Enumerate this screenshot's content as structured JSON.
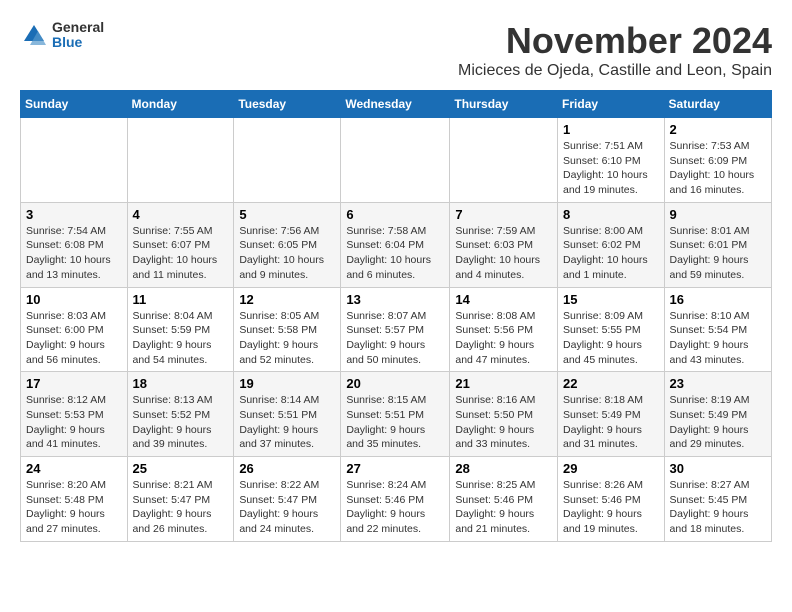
{
  "logo": {
    "general": "General",
    "blue": "Blue"
  },
  "title": "November 2024",
  "location": "Micieces de Ojeda, Castille and Leon, Spain",
  "weekdays": [
    "Sunday",
    "Monday",
    "Tuesday",
    "Wednesday",
    "Thursday",
    "Friday",
    "Saturday"
  ],
  "weeks": [
    [
      {
        "day": "",
        "info": ""
      },
      {
        "day": "",
        "info": ""
      },
      {
        "day": "",
        "info": ""
      },
      {
        "day": "",
        "info": ""
      },
      {
        "day": "",
        "info": ""
      },
      {
        "day": "1",
        "info": "Sunrise: 7:51 AM\nSunset: 6:10 PM\nDaylight: 10 hours and 19 minutes."
      },
      {
        "day": "2",
        "info": "Sunrise: 7:53 AM\nSunset: 6:09 PM\nDaylight: 10 hours and 16 minutes."
      }
    ],
    [
      {
        "day": "3",
        "info": "Sunrise: 7:54 AM\nSunset: 6:08 PM\nDaylight: 10 hours and 13 minutes."
      },
      {
        "day": "4",
        "info": "Sunrise: 7:55 AM\nSunset: 6:07 PM\nDaylight: 10 hours and 11 minutes."
      },
      {
        "day": "5",
        "info": "Sunrise: 7:56 AM\nSunset: 6:05 PM\nDaylight: 10 hours and 9 minutes."
      },
      {
        "day": "6",
        "info": "Sunrise: 7:58 AM\nSunset: 6:04 PM\nDaylight: 10 hours and 6 minutes."
      },
      {
        "day": "7",
        "info": "Sunrise: 7:59 AM\nSunset: 6:03 PM\nDaylight: 10 hours and 4 minutes."
      },
      {
        "day": "8",
        "info": "Sunrise: 8:00 AM\nSunset: 6:02 PM\nDaylight: 10 hours and 1 minute."
      },
      {
        "day": "9",
        "info": "Sunrise: 8:01 AM\nSunset: 6:01 PM\nDaylight: 9 hours and 59 minutes."
      }
    ],
    [
      {
        "day": "10",
        "info": "Sunrise: 8:03 AM\nSunset: 6:00 PM\nDaylight: 9 hours and 56 minutes."
      },
      {
        "day": "11",
        "info": "Sunrise: 8:04 AM\nSunset: 5:59 PM\nDaylight: 9 hours and 54 minutes."
      },
      {
        "day": "12",
        "info": "Sunrise: 8:05 AM\nSunset: 5:58 PM\nDaylight: 9 hours and 52 minutes."
      },
      {
        "day": "13",
        "info": "Sunrise: 8:07 AM\nSunset: 5:57 PM\nDaylight: 9 hours and 50 minutes."
      },
      {
        "day": "14",
        "info": "Sunrise: 8:08 AM\nSunset: 5:56 PM\nDaylight: 9 hours and 47 minutes."
      },
      {
        "day": "15",
        "info": "Sunrise: 8:09 AM\nSunset: 5:55 PM\nDaylight: 9 hours and 45 minutes."
      },
      {
        "day": "16",
        "info": "Sunrise: 8:10 AM\nSunset: 5:54 PM\nDaylight: 9 hours and 43 minutes."
      }
    ],
    [
      {
        "day": "17",
        "info": "Sunrise: 8:12 AM\nSunset: 5:53 PM\nDaylight: 9 hours and 41 minutes."
      },
      {
        "day": "18",
        "info": "Sunrise: 8:13 AM\nSunset: 5:52 PM\nDaylight: 9 hours and 39 minutes."
      },
      {
        "day": "19",
        "info": "Sunrise: 8:14 AM\nSunset: 5:51 PM\nDaylight: 9 hours and 37 minutes."
      },
      {
        "day": "20",
        "info": "Sunrise: 8:15 AM\nSunset: 5:51 PM\nDaylight: 9 hours and 35 minutes."
      },
      {
        "day": "21",
        "info": "Sunrise: 8:16 AM\nSunset: 5:50 PM\nDaylight: 9 hours and 33 minutes."
      },
      {
        "day": "22",
        "info": "Sunrise: 8:18 AM\nSunset: 5:49 PM\nDaylight: 9 hours and 31 minutes."
      },
      {
        "day": "23",
        "info": "Sunrise: 8:19 AM\nSunset: 5:49 PM\nDaylight: 9 hours and 29 minutes."
      }
    ],
    [
      {
        "day": "24",
        "info": "Sunrise: 8:20 AM\nSunset: 5:48 PM\nDaylight: 9 hours and 27 minutes."
      },
      {
        "day": "25",
        "info": "Sunrise: 8:21 AM\nSunset: 5:47 PM\nDaylight: 9 hours and 26 minutes."
      },
      {
        "day": "26",
        "info": "Sunrise: 8:22 AM\nSunset: 5:47 PM\nDaylight: 9 hours and 24 minutes."
      },
      {
        "day": "27",
        "info": "Sunrise: 8:24 AM\nSunset: 5:46 PM\nDaylight: 9 hours and 22 minutes."
      },
      {
        "day": "28",
        "info": "Sunrise: 8:25 AM\nSunset: 5:46 PM\nDaylight: 9 hours and 21 minutes."
      },
      {
        "day": "29",
        "info": "Sunrise: 8:26 AM\nSunset: 5:46 PM\nDaylight: 9 hours and 19 minutes."
      },
      {
        "day": "30",
        "info": "Sunrise: 8:27 AM\nSunset: 5:45 PM\nDaylight: 9 hours and 18 minutes."
      }
    ]
  ]
}
